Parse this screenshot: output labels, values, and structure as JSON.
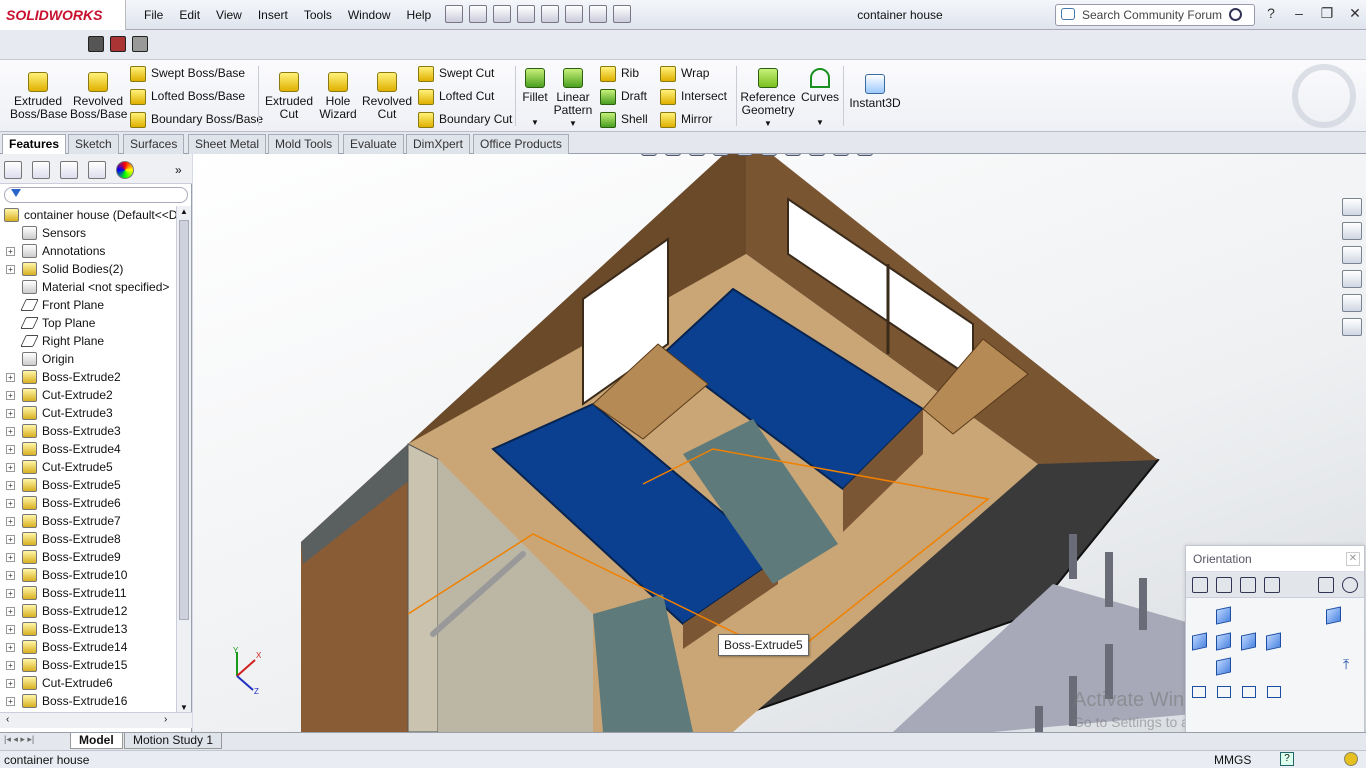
{
  "app": {
    "brand": "SOLIDWORKS",
    "doc_title": "container house"
  },
  "menu": [
    "File",
    "Edit",
    "View",
    "Insert",
    "Tools",
    "Window",
    "Help"
  ],
  "search": {
    "placeholder": "Search Community Forum"
  },
  "ribbon": {
    "extruded_boss": "Extruded\nBoss/Base",
    "revolved_boss": "Revolved\nBoss/Base",
    "swept_boss": "Swept Boss/Base",
    "lofted_boss": "Lofted Boss/Base",
    "boundary_boss": "Boundary Boss/Base",
    "extruded_cut": "Extruded\nCut",
    "hole_wizard": "Hole\nWizard",
    "revolved_cut": "Revolved\nCut",
    "swept_cut": "Swept Cut",
    "lofted_cut": "Lofted Cut",
    "boundary_cut": "Boundary Cut",
    "fillet": "Fillet",
    "linear_pattern": "Linear\nPattern",
    "rib": "Rib",
    "draft": "Draft",
    "shell": "Shell",
    "wrap": "Wrap",
    "intersect": "Intersect",
    "mirror": "Mirror",
    "reference_geometry": "Reference\nGeometry",
    "curves": "Curves",
    "instant3d": "Instant3D"
  },
  "tabs": [
    "Features",
    "Sketch",
    "Surfaces",
    "Sheet Metal",
    "Mold Tools",
    "Evaluate",
    "DimXpert",
    "Office Products"
  ],
  "tree": {
    "root": "container house  (Default<<D",
    "items": [
      {
        "label": "Sensors",
        "exp": false,
        "kind": "gray"
      },
      {
        "label": "Annotations",
        "exp": true,
        "kind": "gray"
      },
      {
        "label": "Solid Bodies(2)",
        "exp": true,
        "kind": "feat"
      },
      {
        "label": "Material <not specified>",
        "exp": false,
        "kind": "gray"
      },
      {
        "label": "Front Plane",
        "exp": false,
        "kind": "plane"
      },
      {
        "label": "Top Plane",
        "exp": false,
        "kind": "plane"
      },
      {
        "label": "Right Plane",
        "exp": false,
        "kind": "plane"
      },
      {
        "label": "Origin",
        "exp": false,
        "kind": "gray"
      },
      {
        "label": "Boss-Extrude2",
        "exp": true,
        "kind": "feat"
      },
      {
        "label": "Cut-Extrude2",
        "exp": true,
        "kind": "feat"
      },
      {
        "label": "Cut-Extrude3",
        "exp": true,
        "kind": "feat"
      },
      {
        "label": "Boss-Extrude3",
        "exp": true,
        "kind": "feat"
      },
      {
        "label": "Boss-Extrude4",
        "exp": true,
        "kind": "feat"
      },
      {
        "label": "Cut-Extrude5",
        "exp": true,
        "kind": "feat"
      },
      {
        "label": "Boss-Extrude5",
        "exp": true,
        "kind": "feat"
      },
      {
        "label": "Boss-Extrude6",
        "exp": true,
        "kind": "feat"
      },
      {
        "label": "Boss-Extrude7",
        "exp": true,
        "kind": "feat"
      },
      {
        "label": "Boss-Extrude8",
        "exp": true,
        "kind": "feat"
      },
      {
        "label": "Boss-Extrude9",
        "exp": true,
        "kind": "feat"
      },
      {
        "label": "Boss-Extrude10",
        "exp": true,
        "kind": "feat"
      },
      {
        "label": "Boss-Extrude11",
        "exp": true,
        "kind": "feat"
      },
      {
        "label": "Boss-Extrude12",
        "exp": true,
        "kind": "feat"
      },
      {
        "label": "Boss-Extrude13",
        "exp": true,
        "kind": "feat"
      },
      {
        "label": "Boss-Extrude14",
        "exp": true,
        "kind": "feat"
      },
      {
        "label": "Boss-Extrude15",
        "exp": true,
        "kind": "feat"
      },
      {
        "label": "Cut-Extrude6",
        "exp": true,
        "kind": "feat"
      },
      {
        "label": "Boss-Extrude16",
        "exp": true,
        "kind": "feat"
      }
    ]
  },
  "viewport": {
    "tooltip": "Boss-Extrude5"
  },
  "orientation": {
    "title": "Orientation"
  },
  "watermark": {
    "line1": "Activate Windows",
    "line2": "Go to Settings to activate Windows."
  },
  "bottom_tabs": [
    "Model",
    "Motion Study 1"
  ],
  "status": {
    "left": "container house",
    "units": "MMGS"
  },
  "colors": {
    "brand": "#c8102e",
    "bed": "#0b3f8f",
    "wood": "#7a5230",
    "floor": "#3b3b3b"
  }
}
